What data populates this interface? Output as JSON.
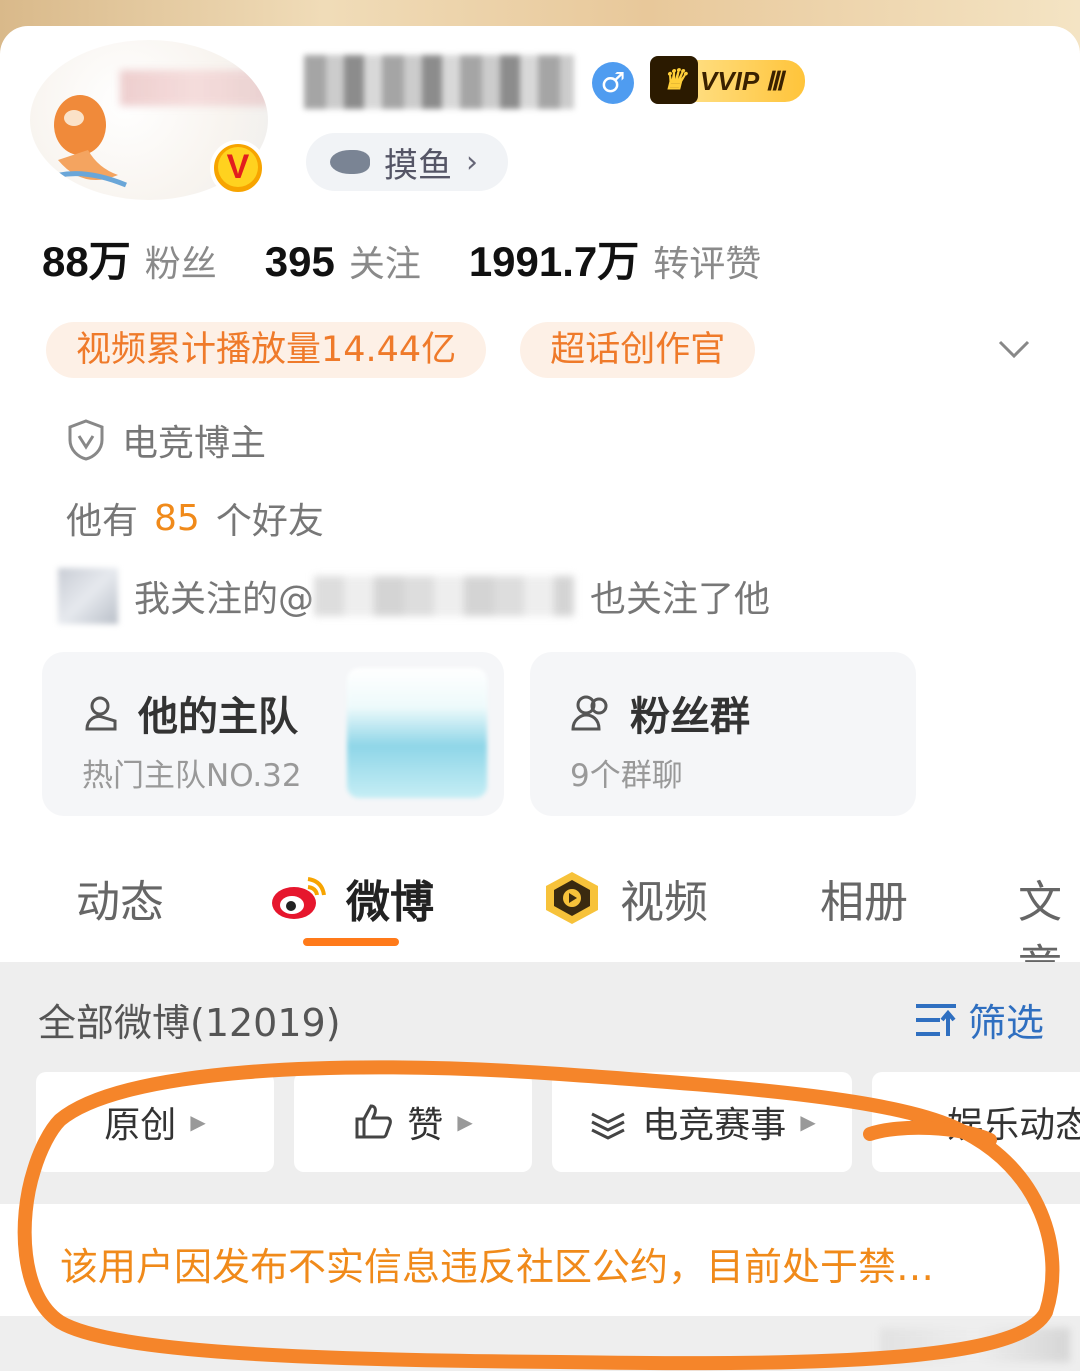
{
  "profile": {
    "gender_symbol": "♂",
    "vip_label": "VVIP Ⅲ",
    "verified_symbol": "V",
    "tag_label": "摸鱼",
    "tag_chevron": "›"
  },
  "stats": [
    {
      "num": "88万",
      "label": "粉丝"
    },
    {
      "num": "395",
      "label": "关注"
    },
    {
      "num": "1991.7万",
      "label": "转评赞"
    }
  ],
  "badges": [
    "视频累计播放量14.44亿",
    "超话创作官"
  ],
  "info": {
    "category": "电竞博主",
    "friends_prefix": "他有",
    "friends_count": "85",
    "friends_suffix": "个好友",
    "mutual_prefix": "我关注的@",
    "mutual_suffix": "也关注了他"
  },
  "cards": {
    "team_title": "他的主队",
    "team_sub": "热门主队NO.32",
    "fans_title": "粉丝群",
    "fans_sub": "9个群聊"
  },
  "tabs": [
    "动态",
    "微博",
    "视频",
    "相册",
    "文章"
  ],
  "active_tab": "微博",
  "feed": {
    "all_label": "全部微博(12019)",
    "filter_label": "筛选",
    "chips": [
      "原创",
      "赞",
      "电竞赛事",
      "娱乐动态"
    ]
  },
  "notice": "该用户因发布不实信息违反社区公约，目前处于禁…",
  "colors": {
    "accent": "#ff7a1a",
    "notice": "#f08a1a",
    "filter": "#2f6fc0",
    "gender": "#4f9cf0",
    "annotation_circle": "#f5852a"
  },
  "icons": [
    "shield-icon",
    "team-icon",
    "fans-group-icon",
    "weibo-icon",
    "video-icon",
    "filter-icon",
    "like-icon",
    "fish-icon",
    "chevron-down-icon"
  ]
}
